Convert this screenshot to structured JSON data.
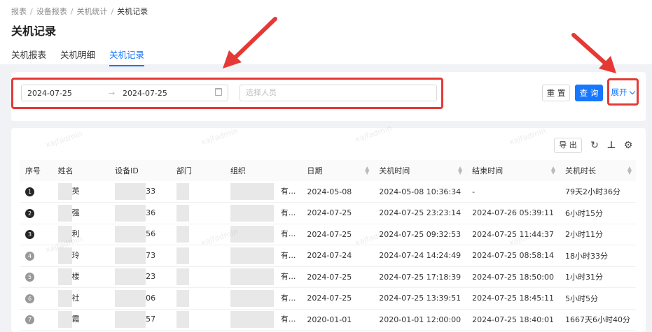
{
  "breadcrumb": [
    "报表",
    "设备报表",
    "关机统计",
    "关机记录"
  ],
  "page_title": "关机记录",
  "tabs": [
    {
      "label": "关机报表",
      "active": false
    },
    {
      "label": "关机明细",
      "active": false
    },
    {
      "label": "关机记录",
      "active": true
    }
  ],
  "filters": {
    "date_start": "2024-07-25",
    "date_end": "2024-07-25",
    "person_placeholder": "选择人员",
    "reset_label": "重 置",
    "search_label": "查 询",
    "expand_label": "展开"
  },
  "toolbar": {
    "export_label": "导 出"
  },
  "watermark": "xajfadmin",
  "table": {
    "columns": [
      "序号",
      "姓名",
      "设备ID",
      "部门",
      "组织",
      "日期",
      "关机时间",
      "结束时间",
      "关机时长"
    ],
    "rows": [
      {
        "index": "1",
        "name": "英",
        "device": "33",
        "org": "有...",
        "date": "2024-05-08",
        "shutdown": "2024-05-08 10:36:34",
        "end": "-",
        "duration": "79天2小时36分"
      },
      {
        "index": "2",
        "name": "强",
        "device": "36",
        "org": "有...",
        "date": "2024-07-25",
        "shutdown": "2024-07-25 23:23:14",
        "end": "2024-07-26 05:39:11",
        "duration": "6小时15分"
      },
      {
        "index": "3",
        "name": "利",
        "device": "56",
        "org": "有...",
        "date": "2024-07-25",
        "shutdown": "2024-07-25 09:32:53",
        "end": "2024-07-25 11:44:37",
        "duration": "2小时11分"
      },
      {
        "index": "4",
        "name": "玲",
        "device": "73",
        "org": "有...",
        "date": "2024-07-24",
        "shutdown": "2024-07-24 14:24:49",
        "end": "2024-07-25 08:58:14",
        "duration": "18小时33分"
      },
      {
        "index": "5",
        "name": "楼",
        "device": "23",
        "org": "有...",
        "date": "2024-07-25",
        "shutdown": "2024-07-25 17:18:39",
        "end": "2024-07-25 18:50:00",
        "duration": "1小时31分"
      },
      {
        "index": "6",
        "name": "社",
        "device": "06",
        "org": "有...",
        "date": "2024-07-25",
        "shutdown": "2024-07-25 13:39:51",
        "end": "2024-07-25 18:45:11",
        "duration": "5小时5分"
      },
      {
        "index": "7",
        "name": "霞",
        "device": "57",
        "org": "有...",
        "date": "2020-01-01",
        "shutdown": "2020-01-01 12:00:00",
        "end": "2024-07-25 18:40:01",
        "duration": "1667天6小时40分"
      }
    ]
  },
  "colors": {
    "accent": "#1677ff",
    "annotation": "#e53935"
  }
}
